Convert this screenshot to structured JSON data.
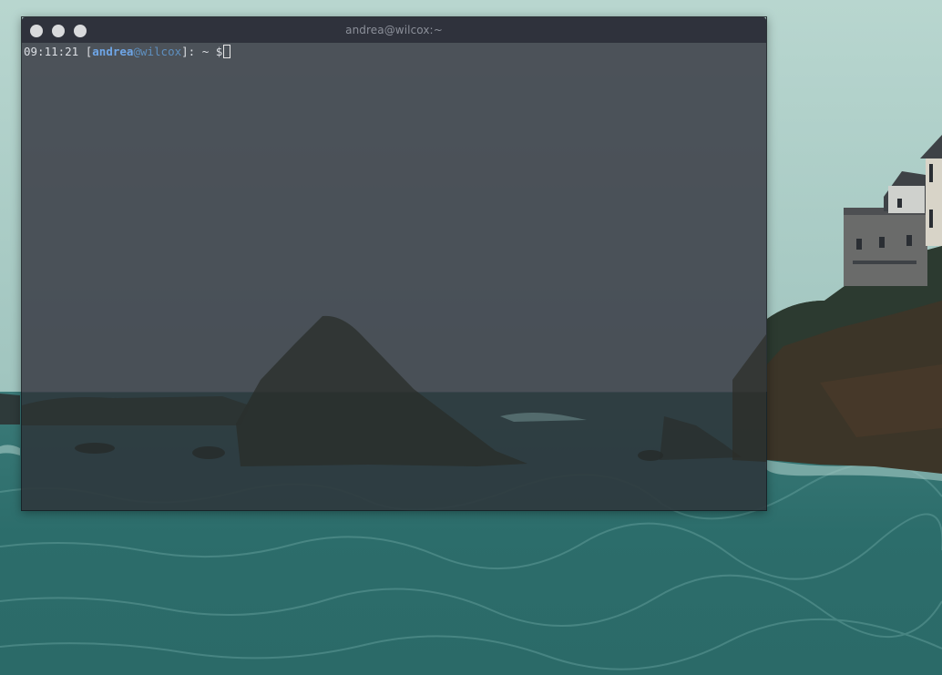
{
  "window": {
    "title": "andrea@wilcox:~"
  },
  "terminal": {
    "time": "09:11:21",
    "open_bracket": " [",
    "user": "andrea",
    "at": "@",
    "host": "wilcox",
    "close_path": "]: ~ $"
  },
  "colors": {
    "titlebar": "#2f323c",
    "terminal_bg": "#3a3d46",
    "user": "#6ea5e6",
    "host": "#5e8fbf",
    "text": "#dcdfe4"
  },
  "icons": {
    "close": "circle",
    "minimize": "circle",
    "maximize": "circle"
  }
}
